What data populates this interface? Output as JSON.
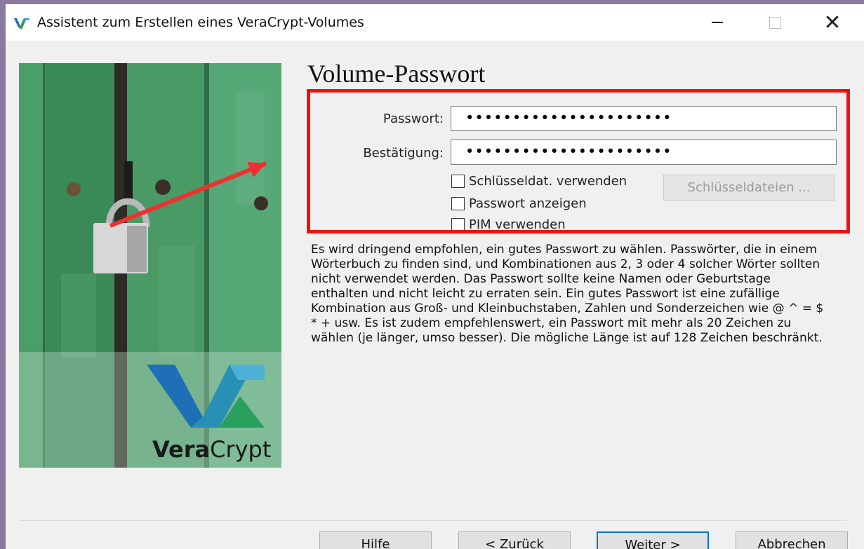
{
  "window": {
    "title": "Assistent zum Erstellen eines VeraCrypt-Volumes",
    "controls": {
      "minimize": "—",
      "maximize": "□",
      "close": "✕"
    }
  },
  "panel": {
    "brand_vera": "Vera",
    "brand_crypt": "Crypt"
  },
  "main": {
    "heading": "Volume-Passwort",
    "password_label": "Passwort:",
    "password_value": "••••••••••••••••••••••",
    "confirm_label": "Bestätigung:",
    "confirm_value": "••••••••••••••••••••••",
    "use_keyfiles_label": "Schlüsseldat. verwenden",
    "show_password_label": "Passwort anzeigen",
    "use_pim_label": "PIM verwenden",
    "keyfiles_button": "Schlüsseldateien ...",
    "info_lines": [
      "Es wird dringend empfohlen, ein gutes Passwort zu wählen. Passwörter, die in einem",
      "Wörterbuch zu finden sind, und Kombinationen aus 2, 3 oder 4 solcher Wörter sollten",
      "nicht verwendet werden. Das Passwort sollte keine Namen oder Geburtstage",
      "enthalten und nicht leicht zu erraten sein. Ein gutes Passwort ist eine zufällige",
      "Kombination aus Groß- und Kleinbuchstaben, Zahlen und Sonderzeichen wie @ ^ = $",
      "* + usw. Es ist zudem empfehlenswert, ein Passwort mit mehr als 20 Zeichen zu",
      "wählen (je länger, umso besser). Die mögliche Länge ist auf 128 Zeichen beschränkt."
    ]
  },
  "footer": {
    "help": "Hilfe",
    "back": "< Zurück",
    "next": "Weiter >",
    "cancel": "Abbrechen"
  },
  "colors": {
    "annotation_red": "#ee1111",
    "door_green": "#3f8f5c",
    "logo_blue": "#1f6fb6",
    "primary_button_border": "#0a6fd1"
  }
}
